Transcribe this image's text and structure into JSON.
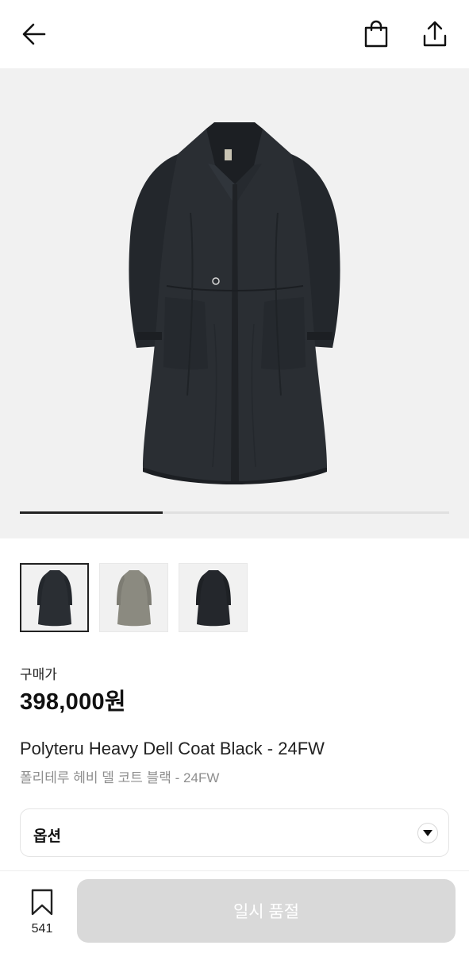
{
  "header": {
    "back_icon": "arrow-left-icon",
    "bag_icon": "shopping-bag-icon",
    "share_icon": "share-upload-icon"
  },
  "gallery": {
    "current_index": 1,
    "total_images": 3,
    "progress_fraction": 0.333
  },
  "thumbnails": [
    {
      "name": "black-coat",
      "color": "#2a2e33",
      "active": true
    },
    {
      "name": "khaki-coat",
      "color": "#8b8a80",
      "active": false
    },
    {
      "name": "black-coat-alt",
      "color": "#24272c",
      "active": false
    }
  ],
  "price": {
    "label": "구매가",
    "value": "398,000원"
  },
  "product": {
    "title_en": "Polyteru Heavy Dell Coat Black - 24FW",
    "title_ko": "폴리테루 헤비 델 코트 블랙 - 24FW"
  },
  "option": {
    "label": "옵션",
    "chevron_icon": "chevron-down-icon"
  },
  "footer": {
    "bookmark_icon": "bookmark-icon",
    "wish_count": "541",
    "soldout_label": "일시 품절"
  },
  "colors": {
    "coat_primary": "#2a2e33",
    "coat_alt": "#8b8a80",
    "disabled_button": "#d9d9d9",
    "price_text": "#111111",
    "subtitle_text": "#8e8e8e"
  }
}
